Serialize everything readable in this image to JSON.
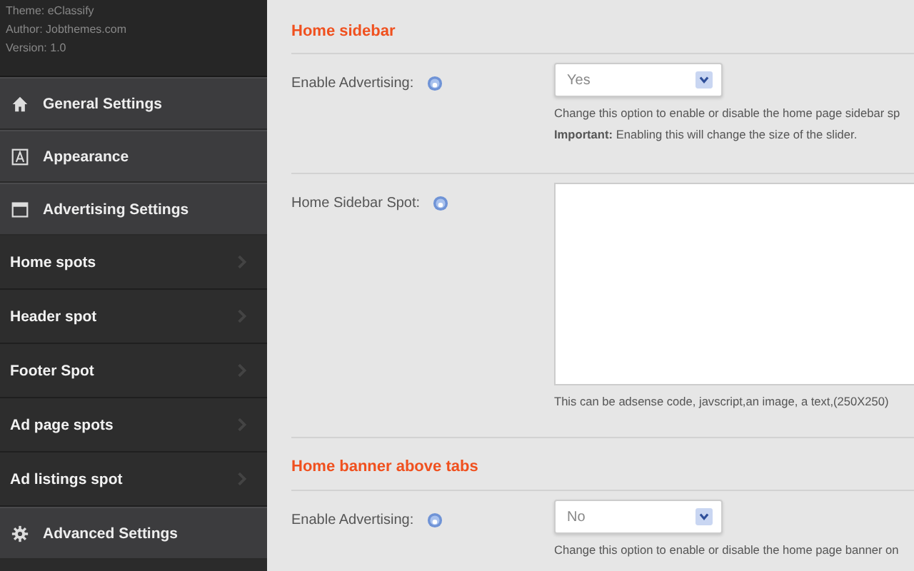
{
  "sidebar": {
    "theme_info": [
      "Theme: eClassify",
      "Author: Jobthemes.com",
      "Version: 1.0"
    ],
    "items": [
      {
        "label": "General Settings",
        "kind": "section"
      },
      {
        "label": "Appearance",
        "kind": "section"
      },
      {
        "label": "Advertising Settings",
        "kind": "section"
      },
      {
        "label": "Home spots",
        "kind": "sub"
      },
      {
        "label": "Header spot",
        "kind": "sub"
      },
      {
        "label": "Footer Spot",
        "kind": "sub"
      },
      {
        "label": "Ad page spots",
        "kind": "sub"
      },
      {
        "label": "Ad listings spot",
        "kind": "sub"
      },
      {
        "label": "Advanced Settings",
        "kind": "section"
      }
    ]
  },
  "sections": [
    {
      "heading": "Home sidebar",
      "fields": [
        {
          "kind": "select",
          "label": "Enable Advertising:",
          "value": "Yes",
          "help": "Change this option to enable or disable the home page sidebar sp",
          "note": "**Important:** Enabling this will change the size of the slider."
        },
        {
          "kind": "textarea",
          "label": "Home Sidebar Spot:",
          "help": "This can be adsense code, javscript,an image, a text,(250X250)"
        }
      ]
    },
    {
      "heading": "Home banner above tabs",
      "fields": [
        {
          "kind": "select",
          "label": "Enable Advertising:",
          "value": "No",
          "help": "Change this option to enable or disable the home page banner on"
        }
      ]
    }
  ]
}
